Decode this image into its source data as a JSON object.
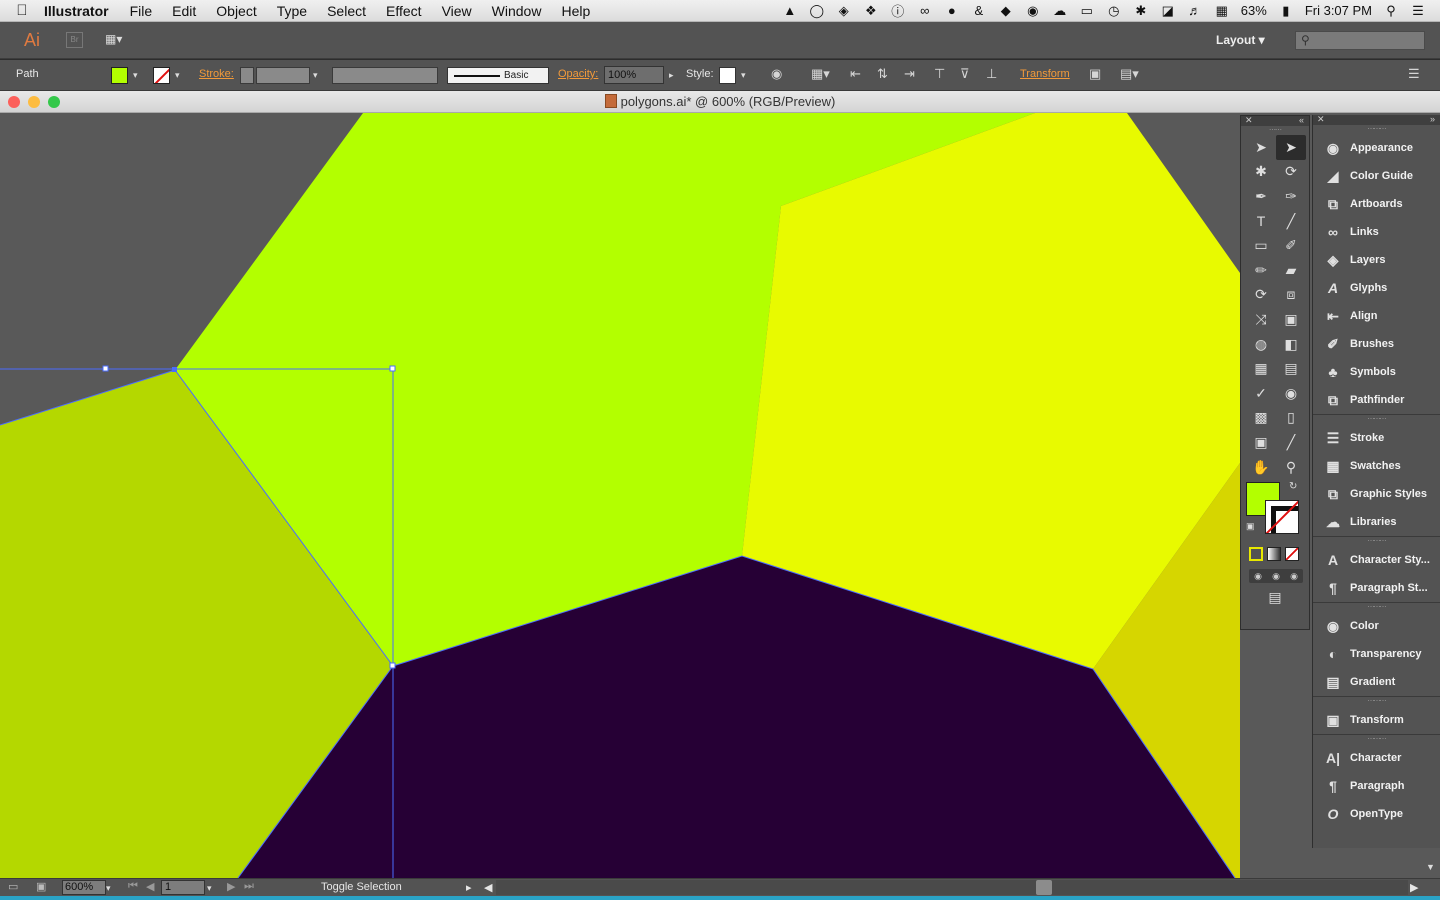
{
  "menubar": {
    "app_name": "Illustrator",
    "items": [
      "File",
      "Edit",
      "Object",
      "Type",
      "Select",
      "Effect",
      "View",
      "Window",
      "Help"
    ],
    "battery": "63%",
    "clock": "Fri 3:07 PM"
  },
  "appbar": {
    "logo": "Ai",
    "bridge": "Br",
    "workspace": "Layout"
  },
  "control_bar": {
    "selection": "Path",
    "stroke_label": "Stroke:",
    "brush_style": "Basic",
    "opacity_label": "Opacity:",
    "opacity_value": "100%",
    "style_label": "Style:",
    "transform_label": "Transform",
    "fill_color": "#b3ff00"
  },
  "document": {
    "title": "polygons.ai* @ 600% (RGB/Preview)"
  },
  "canvas": {
    "colors": {
      "pasteboard": "#595959",
      "lime": "#b3ff00",
      "olive": "#b4d800",
      "yellow": "#e8fa00",
      "mustard": "#d6d600",
      "dark_purple": "#260035",
      "selection": "#4a6cff"
    }
  },
  "dock": {
    "groups": [
      [
        "Appearance",
        "Color Guide",
        "Artboards",
        "Links",
        "Layers",
        "Glyphs",
        "Align",
        "Brushes",
        "Symbols",
        "Pathfinder"
      ],
      [
        "Stroke",
        "Swatches",
        "Graphic Styles",
        "Libraries"
      ],
      [
        "Character Sty...",
        "Paragraph St..."
      ],
      [
        "Color",
        "Transparency",
        "Gradient"
      ],
      [
        "Transform"
      ],
      [
        "Character",
        "Paragraph",
        "OpenType"
      ]
    ]
  },
  "status_bar": {
    "zoom": "600%",
    "page": "1",
    "status_text": "Toggle Selection"
  }
}
